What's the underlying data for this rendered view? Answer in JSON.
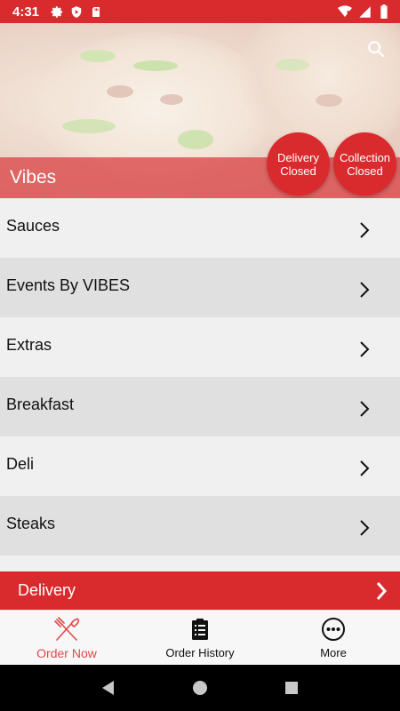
{
  "status_bar": {
    "time": "4:31",
    "left_icons": [
      "gear-icon",
      "shield-icon",
      "sd-card-icon"
    ],
    "right_icons": [
      "wifi-icon",
      "cell-signal-icon",
      "battery-icon"
    ]
  },
  "hero": {
    "title": "Vibes",
    "search_icon": "search-icon",
    "delivery_status": {
      "line1": "Delivery",
      "line2": "Closed"
    },
    "collection_status": {
      "line1": "Collection",
      "line2": "Closed"
    }
  },
  "categories": [
    {
      "label": "Sauces"
    },
    {
      "label": "Events By VIBES"
    },
    {
      "label": "Extras"
    },
    {
      "label": "Breakfast"
    },
    {
      "label": "Deli"
    },
    {
      "label": "Steaks"
    }
  ],
  "delivery_bar": {
    "label": "Delivery",
    "icon": "chevron-right-icon"
  },
  "bottom_nav": {
    "items": [
      {
        "label": "Order Now",
        "icon": "fork-knife-icon",
        "active": true
      },
      {
        "label": "Order History",
        "icon": "clipboard-icon",
        "active": false
      },
      {
        "label": "More",
        "icon": "more-dots-icon",
        "active": false
      }
    ]
  },
  "colors": {
    "brand_red": "#d92b2e",
    "active_nav": "#e04848",
    "row_light": "#f0f0f0",
    "row_dark": "#e0e0e0"
  }
}
